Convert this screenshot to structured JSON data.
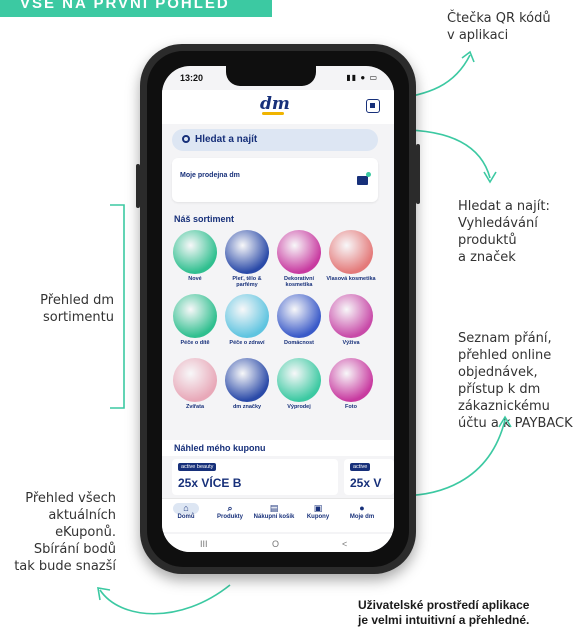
{
  "banner": {
    "title": "VŠE NA PRVNÍ POHLED"
  },
  "annotations": {
    "qr": [
      "Čtečka QR kódů",
      "v aplikaci"
    ],
    "search": [
      "Hledat a najít:",
      "Vyhledávání",
      "produktů",
      "a značek"
    ],
    "assortment": [
      "Přehled dm",
      "sortimentu"
    ],
    "account": [
      "Seznam přání,",
      "přehled online",
      "objednávek,",
      "přístup k dm",
      "zákaznickému",
      "účtu a k PAYBACK"
    ],
    "coupons": [
      "Přehled všech",
      "aktuálních",
      "eKuponů.",
      "Sbírání bodů",
      "tak bude snazší"
    ],
    "footer": [
      "Uživatelské prostředí aplikace",
      "je velmi intuitivní a přehledné."
    ]
  },
  "app": {
    "status": {
      "time": "13:20",
      "icons": "▮▮ ● ▭"
    },
    "logo": "dm",
    "search_label": "Hledat a najít",
    "store_label": "Moje prodejna dm",
    "assortment_title": "Náš sortiment",
    "categories": [
      {
        "label": "Nové",
        "color": "#2fbf8f"
      },
      {
        "label": "Pleť, tělo & parfémy",
        "color": "#2a4aa8"
      },
      {
        "label": "Dekorativní kosmetika",
        "color": "#c83aa0"
      },
      {
        "label": "Vlasová kosmetika",
        "color": "#e47a7a"
      },
      {
        "label": "Péče o dítě",
        "color": "#2fbf8f"
      },
      {
        "label": "Péče o zdraví",
        "color": "#5fc4e0"
      },
      {
        "label": "Domácnost",
        "color": "#3a5ac8"
      },
      {
        "label": "Výživa",
        "color": "#c84aa8"
      },
      {
        "label": "Zvířata",
        "color": "#e8a8b8"
      },
      {
        "label": "dm značky",
        "color": "#2a4aa8"
      },
      {
        "label": "Výprodej",
        "color": "#3cc9a2"
      },
      {
        "label": "Foto",
        "color": "#c83aa0"
      }
    ],
    "coupon_title": "Náhled mého kuponu",
    "coupons": [
      {
        "tag": "active beauty",
        "text": "25x VÍCE B"
      },
      {
        "tag": "active",
        "text": "25x V"
      }
    ],
    "tabs": [
      {
        "label": "Domů",
        "icon": "⌂"
      },
      {
        "label": "Produkty",
        "icon": "⌕"
      },
      {
        "label": "Nákupní košík",
        "icon": "▤"
      },
      {
        "label": "Kupony",
        "icon": "▣"
      },
      {
        "label": "Moje dm",
        "icon": "●"
      }
    ],
    "sysnav": [
      "III",
      "O",
      "<"
    ]
  },
  "colors": {
    "accent": "#3cc9a2",
    "brand": "#17307a"
  }
}
